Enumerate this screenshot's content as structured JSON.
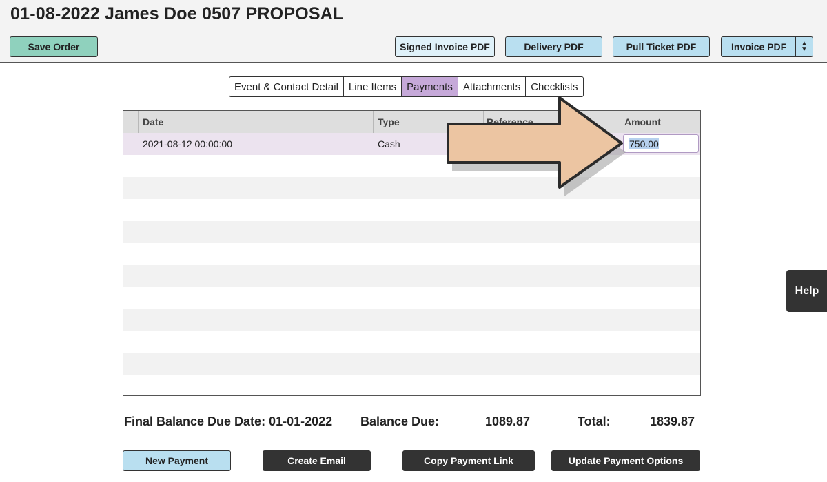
{
  "header": {
    "title": "01-08-2022 James Doe 0507 PROPOSAL"
  },
  "toolbar": {
    "save_label": "Save Order",
    "signed_invoice_label": "Signed Invoice PDF",
    "delivery_label": "Delivery PDF",
    "pull_ticket_label": "Pull Ticket PDF",
    "invoice_label": "Invoice PDF"
  },
  "tabs": [
    {
      "label": "Event & Contact Detail"
    },
    {
      "label": "Line Items"
    },
    {
      "label": "Payments",
      "active": true
    },
    {
      "label": "Attachments"
    },
    {
      "label": "Checklists"
    }
  ],
  "payments_table": {
    "columns": [
      "Date",
      "Type",
      "Reference",
      "Amount"
    ],
    "rows": [
      {
        "date": "2021-08-12 00:00:00",
        "type": "Cash",
        "reference": "",
        "amount": "750.00"
      }
    ]
  },
  "summary": {
    "final_balance_due_label": "Final Balance Due Date: 01-01-2022",
    "balance_due_label": "Balance Due:",
    "balance_due_value": "1089.87",
    "total_label": "Total:",
    "total_value": "1839.87"
  },
  "actions": {
    "new_payment_label": "New Payment",
    "create_email_label": "Create Email",
    "copy_payment_link_label": "Copy Payment Link",
    "update_payment_options_label": "Update Payment Options"
  },
  "help": {
    "label": "Help"
  },
  "colors": {
    "active_tab": "#c6a9d9",
    "save_button": "#8fd1bd",
    "pdf_button": "#b9dff0",
    "arrow_fill": "#ecc5a2"
  }
}
